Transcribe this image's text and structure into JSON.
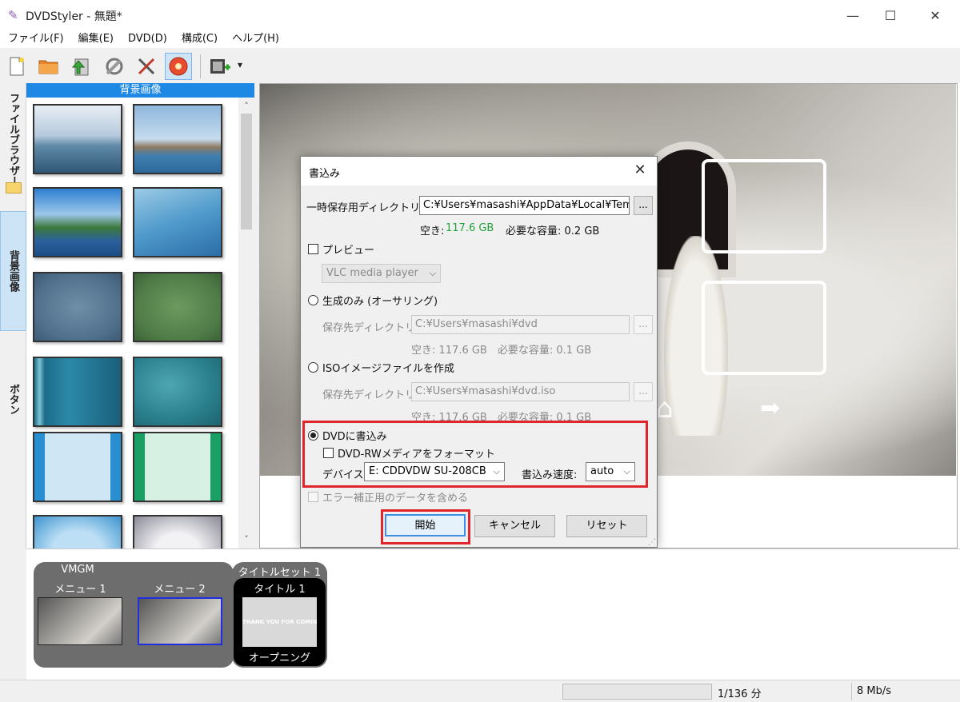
{
  "window": {
    "title": "DVDStyler - 無題*",
    "controls": {
      "minimize": "—",
      "maximize": "☐",
      "close": "✕"
    }
  },
  "menubar": [
    "ファイル(F)",
    "編集(E)",
    "DVD(D)",
    "構成(C)",
    "ヘルプ(H)"
  ],
  "toolbar": {
    "buttons": [
      "new-icon",
      "open-folder-icon",
      "save-icon",
      "settings-icon",
      "tools-icon",
      "burn-disc-icon",
      "add-video-icon"
    ],
    "dropdown_caret": "▾"
  },
  "sidebar": {
    "tabs": [
      "ファイルブラウザー",
      "背景画像",
      "ボタン"
    ],
    "active_tab": "背景画像"
  },
  "thumbnail_panel": {
    "header": "背景画像",
    "scroll_up": "˄",
    "scroll_down": "˅"
  },
  "dialog": {
    "title": "書込み",
    "close": "✕",
    "temp_dir_label": "一時保存用ディレクトリ:",
    "temp_dir_value": "C:¥Users¥masashi¥AppData¥Local¥Temp",
    "browse": "...",
    "free_label": "空き:",
    "free_value": "117.6 GB",
    "required_label": "必要な容量: 0.2 GB",
    "preview_label": "プレビュー",
    "preview_player": "VLC media player",
    "generate_only_label": "生成のみ (オーサリング)",
    "save_dir_label": "保存先ディレクトリ:",
    "generate_dir_value": "C:¥Users¥masashi¥dvd",
    "generate_space": "空き: 117.6 GB　必要な容量: 0.1 GB",
    "iso_label": "ISOイメージファイルを作成",
    "iso_dir_value": "C:¥Users¥masashi¥dvd.iso",
    "iso_space": "空き: 117.6 GB　必要な容量: 0.1 GB",
    "burn_label": "DVDに書込み",
    "format_rw_label": "DVD-RWメディアをフォーマット",
    "device_label": "デバイス:",
    "device_value": "E: CDDVDW SU-208CB",
    "speed_label": "書込み速度:",
    "speed_value": "auto",
    "ecc_label": "エラー補正用のデータを含める",
    "start_button": "開始",
    "cancel_button": "キャンセル",
    "reset_button": "リセット",
    "free_color": "#22a33a"
  },
  "titleset": {
    "vmgm_label": "VMGM",
    "menu1_label": "メニュー 1",
    "menu2_label": "メニュー 2",
    "titleset_label": "タイトルセット 1",
    "title1_label": "タイトル 1",
    "title1_caption": "オープニング",
    "title1_thumb_text": "THANK YOU FOR COMIN"
  },
  "statusbar": {
    "duration": "1/136 分",
    "bitrate": "8 Mb/s"
  },
  "colors": {
    "accent": "#1e88e5",
    "highlight_box": "#e0262d",
    "selected_tab": "#cde4f7"
  }
}
